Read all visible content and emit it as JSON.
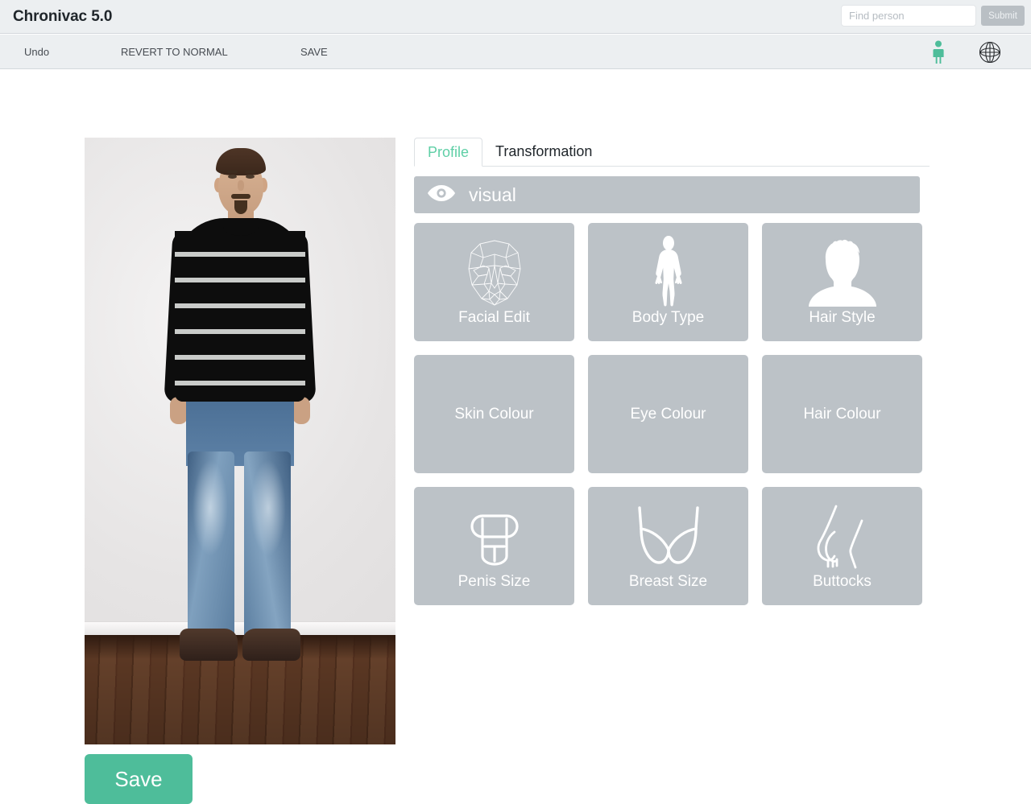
{
  "header": {
    "app_title": "Chronivac 5.0",
    "search": {
      "placeholder": "Find person",
      "value": "",
      "submit_label": "Submit"
    },
    "icons": {
      "person": "person-icon",
      "globe": "globe-icon"
    }
  },
  "toolbar": {
    "undo_label": "Undo",
    "revert_label": "REVERT TO NORMAL",
    "save_label": "SAVE"
  },
  "photo": {
    "alt": "full-body photo of standing man in striped sweater and jeans",
    "save_button_label": "Save"
  },
  "tabs": [
    {
      "label": "Profile",
      "active": true
    },
    {
      "label": "Transformation",
      "active": false
    }
  ],
  "section": {
    "visual_label": "visual",
    "visual_icon": "eye-icon"
  },
  "cards": [
    {
      "label": "Facial Edit",
      "icon": "face-wireframe-icon"
    },
    {
      "label": "Body Type",
      "icon": "body-silhouette-icon"
    },
    {
      "label": "Hair Style",
      "icon": "hair-bust-icon"
    },
    {
      "label": "Skin Colour",
      "icon": ""
    },
    {
      "label": "Eye Colour",
      "icon": ""
    },
    {
      "label": "Hair Colour",
      "icon": ""
    },
    {
      "label": "Penis Size",
      "icon": "penis-icon"
    },
    {
      "label": "Breast Size",
      "icon": "bra-icon"
    },
    {
      "label": "Buttocks",
      "icon": "buttocks-icon"
    }
  ],
  "colors": {
    "accent_green": "#4ebd9a",
    "tab_active_text": "#5fcfa6",
    "card_gray": "#bcc2c7",
    "chrome_gray": "#eceff1"
  }
}
